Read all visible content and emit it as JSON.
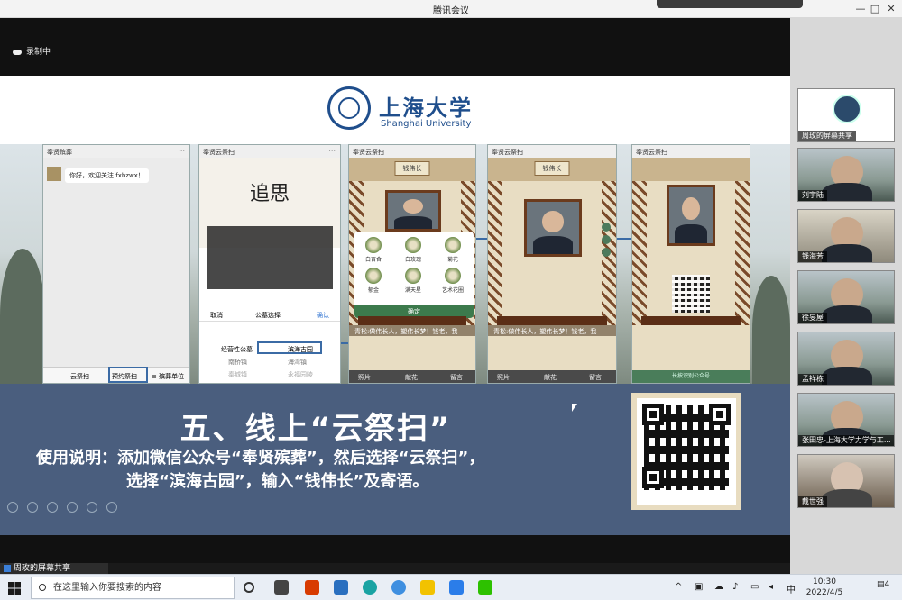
{
  "window": {
    "title": "腾讯会议",
    "controls": [
      "—",
      "□",
      "✕"
    ]
  },
  "recording": {
    "label": "录制中"
  },
  "slide": {
    "university_cn": "上海大学",
    "university_en": "Shanghai University",
    "phone1": {
      "header": "奉贤殡葬",
      "greeting": "你好，欢迎关注 fxbzwx！",
      "tabs": [
        "云祭扫",
        "预约祭扫",
        "≡ 殡葬单位"
      ]
    },
    "phone2": {
      "header": "奉贤云祭扫",
      "calligraphy": "追思",
      "picker_cancel": "取消",
      "picker_title": "公墓选择",
      "picker_confirm": "确认",
      "options": [
        "经营性公墓",
        "滨海古园",
        "南桥镇",
        "海湾镇",
        "奉城镇",
        "永福园陵"
      ]
    },
    "phone3": {
      "header": "奉贤云祭扫",
      "plaque": "钱伟长",
      "flowers": [
        "白百合",
        "白玫瑰",
        "菊花",
        "郁金",
        "满天星",
        "艺术花圈"
      ],
      "confirm": "确定",
      "message": "青松:做伟长人，塑伟长梦！钱老，我",
      "bottom": [
        "照片",
        "献花",
        "留言"
      ]
    },
    "phone4": {
      "header": "奉贤云祭扫",
      "plaque": "钱伟长",
      "message": "青松:做伟长人，塑伟长梦！钱老，我",
      "bottom": [
        "照片",
        "献花",
        "留言"
      ]
    },
    "phone5": {
      "header": "奉贤云祭扫",
      "bottom": "长按识别公众号"
    },
    "heading": "五、线上“云祭扫”",
    "line1": "使用说明：添加微信公众号“奉贤殡葬”，然后选择“云祭扫”，",
    "line2": "选择“滨海古园”，输入“钱伟长”及寄语。"
  },
  "share_indicator": "周玫的屏幕共享",
  "participants": [
    {
      "name": "周玫的屏幕共享"
    },
    {
      "name": "刘宇陆"
    },
    {
      "name": "钱海芳"
    },
    {
      "name": "徐旻屋"
    },
    {
      "name": "孟祥栋"
    },
    {
      "name": "张田忠-上海大学力学与工..."
    },
    {
      "name": "戴世强"
    }
  ],
  "taskbar": {
    "search_placeholder": "在这里输入你要搜索的内容",
    "ime": "中",
    "time": "10:30",
    "date": "2022/4/5",
    "notification_count": "4"
  }
}
